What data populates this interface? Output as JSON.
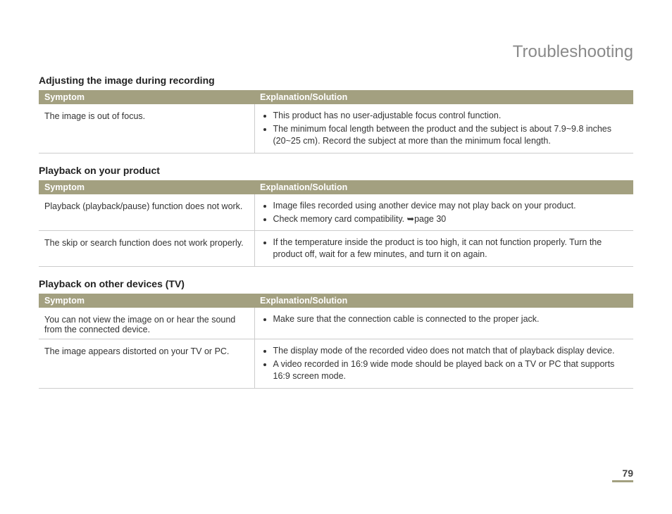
{
  "title": "Troubleshooting",
  "page_number": "79",
  "sections": [
    {
      "heading": "Adjusting the image during recording",
      "header_col1": "Symptom",
      "header_col2": "Explanation/Solution",
      "rows": [
        {
          "symptom": "The image is out of focus.",
          "bullets": [
            "This product has no user-adjustable focus control function.",
            "The minimum focal length between the product and the subject is about 7.9~9.8 inches (20~25 cm). Record the subject at more than the minimum focal length."
          ]
        }
      ]
    },
    {
      "heading": "Playback on your product",
      "header_col1": "Symptom",
      "header_col2": "Explanation/Solution",
      "rows": [
        {
          "symptom": "Playback (playback/pause) function does not work.",
          "bullets": [
            "Image files recorded using another device may not play back on your product.",
            "Check memory card compatibility. ➥page 30"
          ]
        },
        {
          "symptom": "The skip or search function does not work properly.",
          "bullets": [
            "If the temperature inside the product is too high, it can not function properly. Turn the product off, wait for a few minutes, and turn it on again."
          ]
        }
      ]
    },
    {
      "heading": "Playback on other devices (TV)",
      "header_col1": "Symptom",
      "header_col2": "Explanation/Solution",
      "rows": [
        {
          "symptom": "You can not view the image on or hear the sound from the connected device.",
          "bullets": [
            "Make sure that the connection cable is connected to the proper jack."
          ]
        },
        {
          "symptom": "The image appears distorted on your TV or PC.",
          "bullets": [
            "The display mode of the recorded video does not match that of playback display device.",
            "A video recorded in 16:9 wide mode should be played back on a TV or PC that supports 16:9 screen mode."
          ]
        }
      ]
    }
  ]
}
